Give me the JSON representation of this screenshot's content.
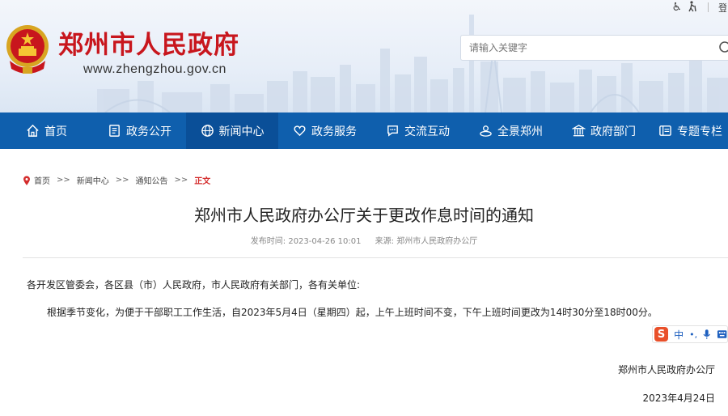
{
  "header": {
    "site_title": "郑州市人民政府",
    "site_url": "www.zhengzhou.gov.cn",
    "login_label": "登",
    "search_placeholder": "请输入关键字"
  },
  "nav": {
    "items": [
      {
        "label": "首页",
        "icon": "home-icon"
      },
      {
        "label": "政务公开",
        "icon": "document-icon"
      },
      {
        "label": "新闻中心",
        "icon": "globe-icon",
        "active": true
      },
      {
        "label": "政务服务",
        "icon": "heart-icon"
      },
      {
        "label": "交流互动",
        "icon": "chat-icon"
      },
      {
        "label": "全景郑州",
        "icon": "panorama-icon"
      },
      {
        "label": "政府部门",
        "icon": "building-icon"
      },
      {
        "label": "专题专栏",
        "icon": "columns-icon"
      }
    ]
  },
  "breadcrumb": {
    "items": [
      "首页",
      "新闻中心",
      "通知公告"
    ],
    "separator": ">>",
    "current": "正文"
  },
  "article": {
    "title": "郑州市人民政府办公厅关于更改作息时间的通知",
    "publish_time": "发布时间:  2023-04-26 10:01",
    "source": "来源:  郑州市人民政府办公厅",
    "salutation": "各开发区管委会，各区县（市）人民政府，市人民政府有关部门，各有关单位:",
    "body": "根据季节变化，为便于干部职工工作生活，自2023年5月4日（星期四）起，上午上班时间不变，下午上班时间更改为14时30分至18时00分。",
    "signature": "郑州市人民政府办公厅",
    "date": "2023年4月24日"
  },
  "ime_toolbar": {
    "logo": "S",
    "mode": "中",
    "punct": "•,"
  },
  "colors": {
    "nav_bg": "#0f5fad",
    "nav_active": "#0a4f98",
    "title_red": "#c8161d",
    "current_crumb": "#d42c2c"
  }
}
